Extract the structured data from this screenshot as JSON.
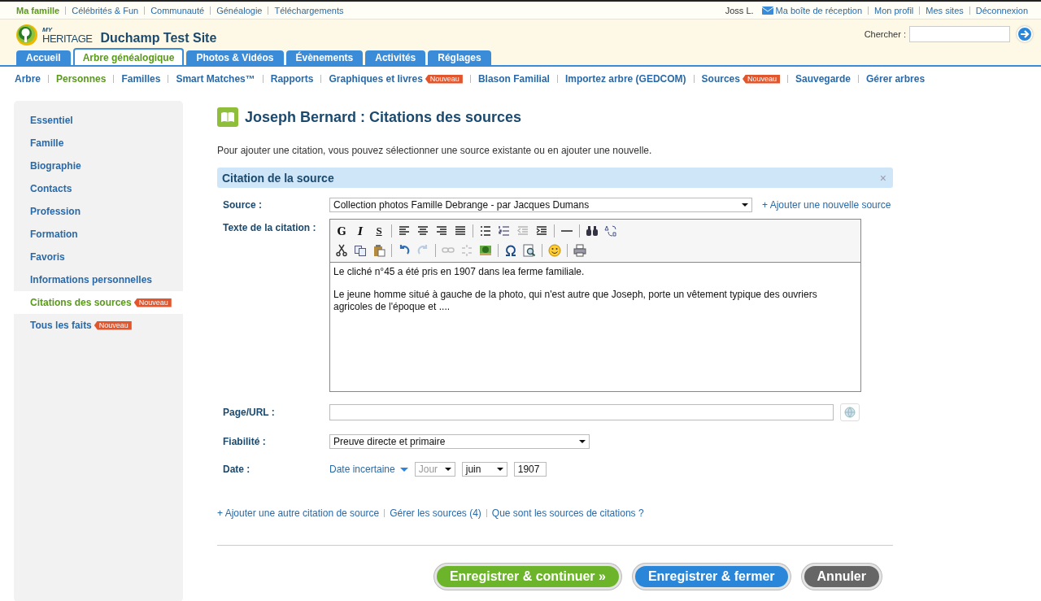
{
  "top_links": [
    {
      "label": "Ma famille",
      "selected": true
    },
    {
      "label": "Célébrités & Fun",
      "selected": false
    },
    {
      "label": "Communauté",
      "selected": false
    },
    {
      "label": "Généalogie",
      "selected": false
    },
    {
      "label": "Téléchargements",
      "selected": false
    }
  ],
  "user": {
    "name": "Joss L.",
    "inbox": "Ma boîte de réception",
    "links": [
      "Mon profil",
      "Mes sites",
      "Déconnexion"
    ]
  },
  "header": {
    "logo_small": "MY",
    "logo_text": "HERITAGE",
    "site_title": "Duchamp Test Site",
    "search_label": "Chercher :"
  },
  "tabs": [
    {
      "label": "Accueil",
      "selected": false
    },
    {
      "label": "Arbre généalogique",
      "selected": true
    },
    {
      "label": "Photos & Vidéos",
      "selected": false
    },
    {
      "label": "Évènements",
      "selected": false
    },
    {
      "label": "Activités",
      "selected": false
    },
    {
      "label": "Réglages",
      "selected": false
    }
  ],
  "subnav": [
    {
      "label": "Arbre",
      "selected": false
    },
    {
      "label": "Personnes",
      "selected": true
    },
    {
      "label": "Familles",
      "selected": false
    },
    {
      "label": "Smart Matches™",
      "selected": false
    },
    {
      "label": "Rapports",
      "selected": false
    },
    {
      "label": "Graphiques et livres",
      "selected": false,
      "badge": "Nouveau"
    },
    {
      "label": "Blason Familial",
      "selected": false
    },
    {
      "label": "Importez arbre (GEDCOM)",
      "selected": false
    },
    {
      "label": "Sources",
      "selected": false,
      "badge": "Nouveau"
    },
    {
      "label": "Sauvegarde",
      "selected": false
    },
    {
      "label": "Gérer arbres",
      "selected": false
    }
  ],
  "sidebar": {
    "items": [
      {
        "label": "Essentiel",
        "selected": false
      },
      {
        "label": "Famille",
        "selected": false
      },
      {
        "label": "Biographie",
        "selected": false
      },
      {
        "label": "Contacts",
        "selected": false
      },
      {
        "label": "Profession",
        "selected": false
      },
      {
        "label": "Formation",
        "selected": false
      },
      {
        "label": "Favoris",
        "selected": false
      },
      {
        "label": "Informations personnelles",
        "selected": false
      },
      {
        "label": "Citations des sources",
        "selected": true,
        "badge": "Nouveau"
      },
      {
        "label": "Tous les faits",
        "selected": false,
        "badge": "Nouveau"
      }
    ]
  },
  "page": {
    "title": "Joseph Bernard : Citations des sources",
    "intro": "Pour ajouter une citation, vous pouvez sélectionner une source existante ou en ajouter une nouvelle."
  },
  "panel": {
    "title": "Citation de la source",
    "close": "×"
  },
  "form": {
    "source_label": "Source :",
    "source_value": "Collection photos Famille Debrange - par Jacques Dumans",
    "add_source": "+ Ajouter une nouvelle source",
    "text_label": "Texte de la citation :",
    "toolbar_rows": [
      [
        [
          {
            "kind": "bold",
            "label": "G"
          },
          {
            "kind": "italic",
            "label": "I"
          },
          {
            "kind": "underline",
            "label": "S"
          }
        ],
        [
          {
            "kind": "icon",
            "disabled": false
          },
          {
            "kind": "icon",
            "disabled": false
          },
          {
            "kind": "icon",
            "disabled": false
          },
          {
            "kind": "icon",
            "disabled": false
          }
        ],
        [
          {
            "kind": "icon",
            "disabled": false
          },
          {
            "kind": "icon",
            "disabled": false
          },
          {
            "kind": "icon",
            "disabled": true
          },
          {
            "kind": "icon",
            "disabled": false
          }
        ],
        [
          {
            "kind": "icon",
            "disabled": false
          }
        ],
        [
          {
            "kind": "icon",
            "disabled": false
          },
          {
            "kind": "icon",
            "disabled": false
          }
        ]
      ],
      [
        [
          {
            "kind": "icon",
            "disabled": false
          },
          {
            "kind": "icon",
            "disabled": false
          },
          {
            "kind": "icon",
            "disabled": false
          }
        ],
        [
          {
            "kind": "icon",
            "disabled": false
          },
          {
            "kind": "icon",
            "disabled": true
          }
        ],
        [
          {
            "kind": "icon",
            "disabled": true
          },
          {
            "kind": "icon",
            "disabled": true
          },
          {
            "kind": "icon",
            "disabled": false
          }
        ],
        [
          {
            "kind": "icon",
            "disabled": false
          },
          {
            "kind": "icon",
            "disabled": false
          }
        ],
        [
          {
            "kind": "icon",
            "disabled": false
          }
        ],
        [
          {
            "kind": "icon",
            "disabled": false
          }
        ]
      ]
    ],
    "text_paragraphs": [
      "Le cliché n°45 a été pris en 1907 dans lea ferme familiale.",
      "Le jeune homme situé à gauche de la photo, qui n'est autre que Joseph, porte un vêtement typique des ouvriers agricoles de l'époque et ...."
    ],
    "page_label": "Page/URL :",
    "reliability_label": "Fiabilité :",
    "reliability_value": "Preuve directe et primaire",
    "date_label": "Date :",
    "date_mode": "Date incertaine",
    "day_placeholder": "Jour",
    "month": "juin",
    "year": "1907"
  },
  "links": [
    "+ Ajouter une autre citation de source",
    "Gérer les sources (4)",
    "Que sont les sources de citations ?"
  ],
  "buttons": [
    {
      "label": "Enregistrer & continuer »",
      "kind": "green"
    },
    {
      "label": "Enregistrer & fermer",
      "kind": "blue"
    },
    {
      "label": "Annuler",
      "kind": "grey"
    }
  ]
}
